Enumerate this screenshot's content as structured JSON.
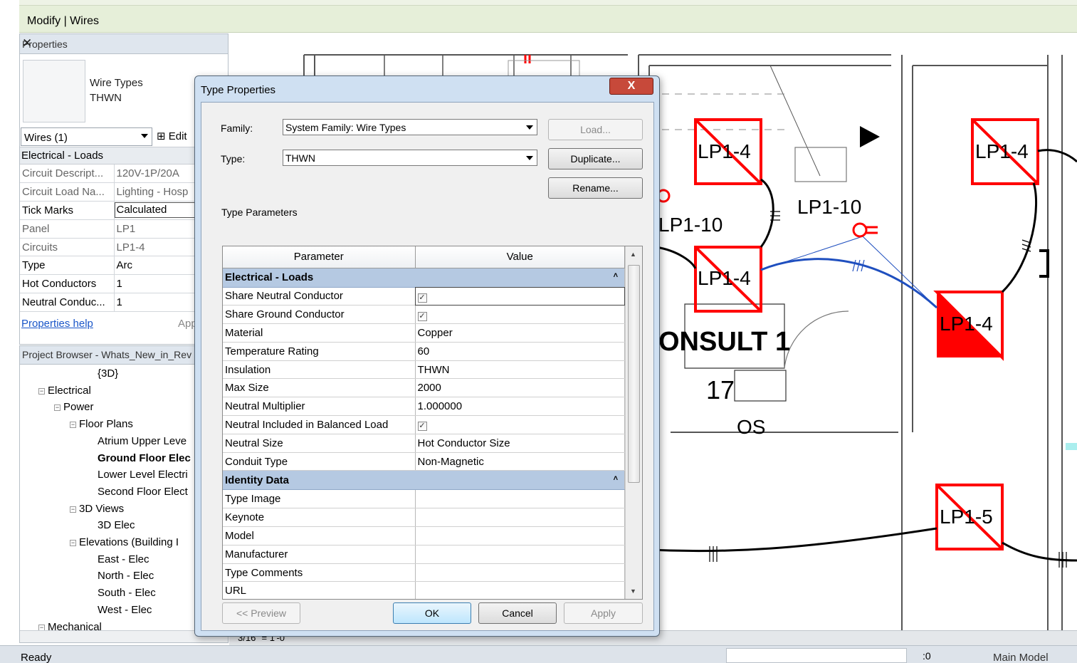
{
  "ribbon": {
    "context_label": "Modify | Wires"
  },
  "properties": {
    "header": "Properties",
    "type_line1": "Wire Types",
    "type_line2": "THWN",
    "selector": "Wires (1)",
    "edit_label": "Edit",
    "category": "Electrical - Loads",
    "rows": [
      {
        "key": "Circuit Descript...",
        "value": "120V-1P/20A",
        "gray": true
      },
      {
        "key": "Circuit Load Na...",
        "value": "Lighting - Hosp",
        "gray": true
      },
      {
        "key": "Tick Marks",
        "value": "Calculated",
        "gray": false
      },
      {
        "key": "Panel",
        "value": "LP1",
        "gray": true
      },
      {
        "key": "Circuits",
        "value": "LP1-4",
        "gray": true
      },
      {
        "key": "Type",
        "value": "Arc",
        "gray": false
      },
      {
        "key": "Hot Conductors",
        "value": "1",
        "gray": false
      },
      {
        "key": "Neutral Conduc...",
        "value": "1",
        "gray": false
      }
    ],
    "help_link": "Properties help",
    "apply_label": "App"
  },
  "browser": {
    "header": "Project Browser - Whats_New_in_Rev",
    "items": [
      {
        "label": "{3D}",
        "indent": 4,
        "toggle": "",
        "bold": false
      },
      {
        "label": "Electrical",
        "indent": 1,
        "toggle": "−",
        "bold": false
      },
      {
        "label": "Power",
        "indent": 2,
        "toggle": "−",
        "bold": false
      },
      {
        "label": "Floor Plans",
        "indent": 3,
        "toggle": "−",
        "bold": false
      },
      {
        "label": "Atrium Upper Leve",
        "indent": 4,
        "toggle": "",
        "bold": false
      },
      {
        "label": "Ground Floor Elec",
        "indent": 4,
        "toggle": "",
        "bold": true
      },
      {
        "label": "Lower Level Electri",
        "indent": 4,
        "toggle": "",
        "bold": false
      },
      {
        "label": "Second Floor Elect",
        "indent": 4,
        "toggle": "",
        "bold": false
      },
      {
        "label": "3D Views",
        "indent": 3,
        "toggle": "−",
        "bold": false
      },
      {
        "label": "3D Elec",
        "indent": 4,
        "toggle": "",
        "bold": false
      },
      {
        "label": "Elevations (Building I",
        "indent": 3,
        "toggle": "−",
        "bold": false
      },
      {
        "label": "East - Elec",
        "indent": 4,
        "toggle": "",
        "bold": false
      },
      {
        "label": "North - Elec",
        "indent": 4,
        "toggle": "",
        "bold": false
      },
      {
        "label": "South - Elec",
        "indent": 4,
        "toggle": "",
        "bold": false
      },
      {
        "label": "West - Elec",
        "indent": 4,
        "toggle": "",
        "bold": false
      },
      {
        "label": "Mechanical",
        "indent": 1,
        "toggle": "−",
        "bold": false
      }
    ]
  },
  "canvas": {
    "tags": [
      "LP1-4",
      "LP1-4",
      "LP1-4",
      "LP1-4",
      "LP1-5"
    ],
    "circuit_labels": [
      "LP1-10",
      "LP1-10"
    ],
    "room_name": "ONSULT 1",
    "room_number": "17",
    "os_tag": "OS",
    "view_scale": "3/16\" = 1'-0\""
  },
  "dialog": {
    "title": "Type Properties",
    "family_label": "Family:",
    "family_value": "System Family: Wire Types",
    "type_label": "Type:",
    "type_value": "THWN",
    "load_button": "Load...",
    "duplicate_button": "Duplicate...",
    "rename_button": "Rename...",
    "type_params_label": "Type Parameters",
    "col_parameter": "Parameter",
    "col_value": "Value",
    "groups": [
      {
        "name": "Electrical - Loads",
        "params": [
          {
            "name": "Share Neutral Conductor",
            "value": "",
            "check": true
          },
          {
            "name": "Share Ground Conductor",
            "value": "",
            "check": true
          },
          {
            "name": "Material",
            "value": "Copper",
            "check": false
          },
          {
            "name": "Temperature Rating",
            "value": "60",
            "check": false
          },
          {
            "name": "Insulation",
            "value": "THWN",
            "check": false
          },
          {
            "name": "Max Size",
            "value": "2000",
            "check": false
          },
          {
            "name": "Neutral Multiplier",
            "value": "1.000000",
            "check": false
          },
          {
            "name": "Neutral Included in Balanced Load",
            "value": "",
            "check": true
          },
          {
            "name": "Neutral Size",
            "value": "Hot Conductor Size",
            "check": false
          },
          {
            "name": "Conduit Type",
            "value": "Non-Magnetic",
            "check": false
          }
        ]
      },
      {
        "name": "Identity Data",
        "params": [
          {
            "name": "Type Image",
            "value": "",
            "check": false
          },
          {
            "name": "Keynote",
            "value": "",
            "check": false
          },
          {
            "name": "Model",
            "value": "",
            "check": false
          },
          {
            "name": "Manufacturer",
            "value": "",
            "check": false
          },
          {
            "name": "Type Comments",
            "value": "",
            "check": false
          },
          {
            "name": "URL",
            "value": "",
            "check": false
          }
        ]
      }
    ],
    "preview_button": "<< Preview",
    "ok_button": "OK",
    "cancel_button": "Cancel",
    "apply_button": "Apply"
  },
  "status": {
    "ready": "Ready",
    "model": "Main Model",
    "zero": ":0"
  },
  "colors": {
    "tag_red": "#ff0000",
    "wire_blue": "#1f4fbf",
    "category_blue": "#b5c9e2",
    "ribbon_green": "#e6efd9"
  }
}
